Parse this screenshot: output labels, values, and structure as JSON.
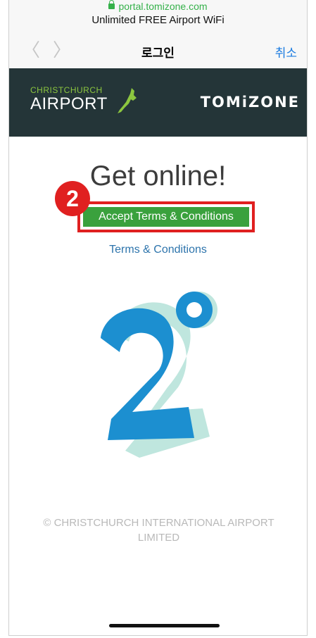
{
  "browser": {
    "url": "portal.tomizone.com",
    "page_title": "Unlimited FREE Airport WiFi",
    "nav_title": "로그인",
    "cancel_label": "취소",
    "back_glyph": "〈",
    "forward_glyph": "〉"
  },
  "header": {
    "airport_small": "CHRISTCHURCH",
    "airport_big": "AIRPORT",
    "brand": "TOMiZONE"
  },
  "main": {
    "heading": "Get online!",
    "accept_button": "Accept Terms & Conditions",
    "terms_link": "Terms & Conditions",
    "step_number": "2",
    "copyright": "© CHRISTCHURCH INTERNATIONAL AIRPORT LIMITED"
  },
  "colors": {
    "header_bg": "#243538",
    "accept_green": "#3aa13d",
    "highlight_red": "#e02020",
    "link_blue": "#2d74ac",
    "logo_blue": "#1c8fd0"
  }
}
